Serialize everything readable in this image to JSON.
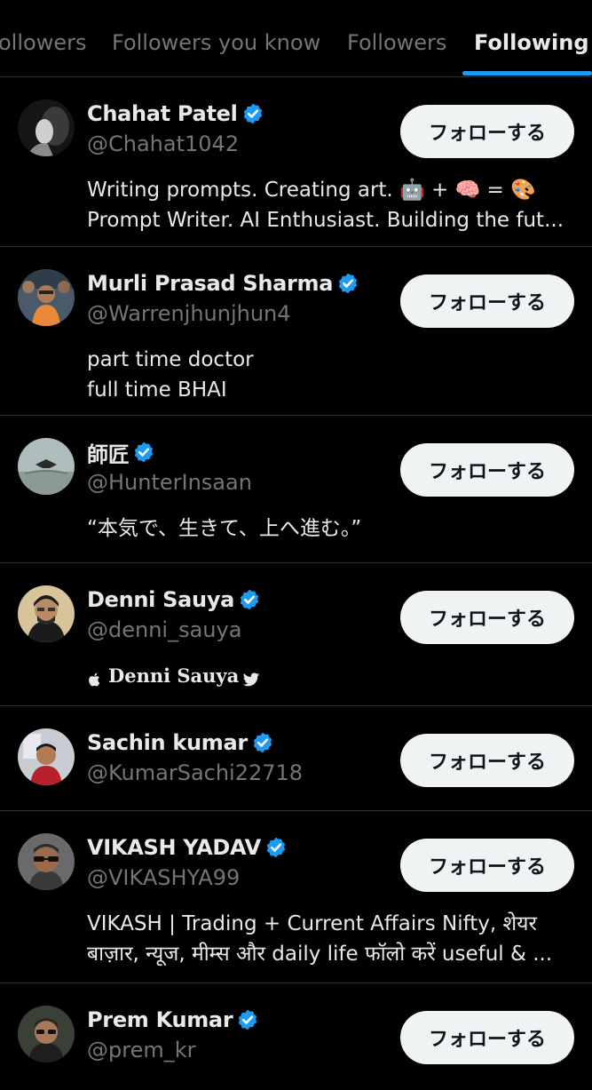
{
  "tabs": [
    {
      "label": "ollowers"
    },
    {
      "label": "Followers you know"
    },
    {
      "label": "Followers"
    },
    {
      "label": "Following"
    }
  ],
  "follow_label": "フォローする",
  "colors": {
    "background": "#000000",
    "accent": "#1d9bf0",
    "text_primary": "#e7e9ea",
    "text_secondary": "#71767b",
    "button_bg": "#eff3f4",
    "divider": "#2f3336"
  },
  "users": [
    {
      "name": "Chahat Patel",
      "handle": "@Chahat1042",
      "bio": [
        "Writing prompts. Creating art. 🤖 + 🧠 = 🎨",
        "Prompt Writer. AI Enthusiast. Building the fut..."
      ]
    },
    {
      "name": "Murli Prasad Sharma",
      "handle": "@Warrenjhunjhun4",
      "bio": [
        "part time doctor",
        "full time BHAI"
      ]
    },
    {
      "name": "師匠",
      "handle": "@HunterInsaan",
      "bio": [
        "“本気で、生きて、上へ進む。”"
      ]
    },
    {
      "name": "Denni Sauya",
      "handle": "@denni_sauya",
      "bio": [
        " Denni Sauya "
      ]
    },
    {
      "name": "Sachin kumar",
      "handle": "@KumarSachi22718",
      "bio": []
    },
    {
      "name": "VIKASH YADAV",
      "handle": "@VIKASHYA99",
      "bio": [
        "VIKASH | Trading + Current Affairs   Nifty, शेयर",
        "बाज़ार, न्यूज, मीम्स और daily life   फॉलो करें useful & ..."
      ]
    },
    {
      "name": "Prem Kumar",
      "handle": "@prem_kr",
      "bio": []
    }
  ]
}
